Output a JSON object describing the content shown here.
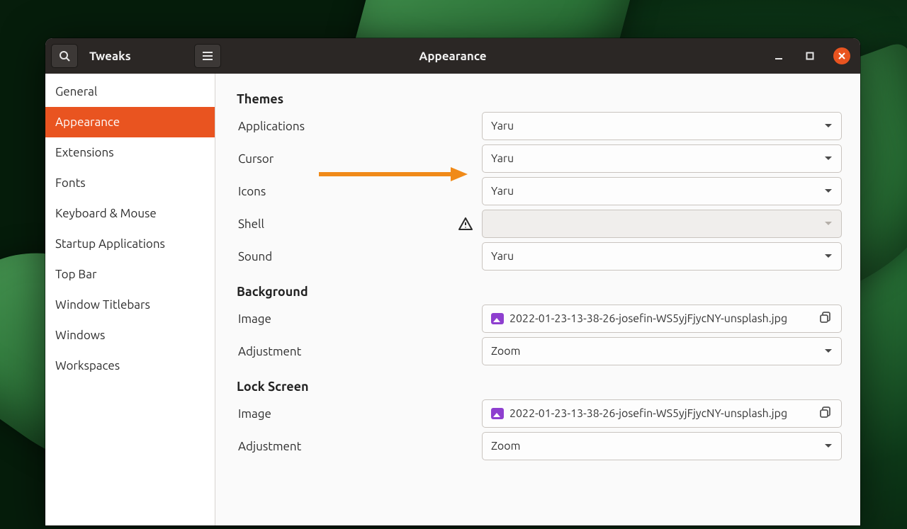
{
  "app_title": "Tweaks",
  "page_title": "Appearance",
  "sidebar": {
    "items": [
      {
        "label": "General"
      },
      {
        "label": "Appearance",
        "active": true
      },
      {
        "label": "Extensions"
      },
      {
        "label": "Fonts"
      },
      {
        "label": "Keyboard & Mouse"
      },
      {
        "label": "Startup Applications"
      },
      {
        "label": "Top Bar"
      },
      {
        "label": "Window Titlebars"
      },
      {
        "label": "Windows"
      },
      {
        "label": "Workspaces"
      }
    ]
  },
  "themes": {
    "heading": "Themes",
    "applications": {
      "label": "Applications",
      "value": "Yaru"
    },
    "cursor": {
      "label": "Cursor",
      "value": "Yaru"
    },
    "icons": {
      "label": "Icons",
      "value": "Yaru"
    },
    "shell": {
      "label": "Shell",
      "value": "",
      "disabled": true,
      "warning": true
    },
    "sound": {
      "label": "Sound",
      "value": "Yaru"
    }
  },
  "background": {
    "heading": "Background",
    "image": {
      "label": "Image",
      "value": "2022-01-23-13-38-26-josefin-WS5yjFjycNY-unsplash.jpg"
    },
    "adjustment": {
      "label": "Adjustment",
      "value": "Zoom"
    }
  },
  "lockscreen": {
    "heading": "Lock Screen",
    "image": {
      "label": "Image",
      "value": "2022-01-23-13-38-26-josefin-WS5yjFjycNY-unsplash.jpg"
    },
    "adjustment": {
      "label": "Adjustment",
      "value": "Zoom"
    }
  }
}
